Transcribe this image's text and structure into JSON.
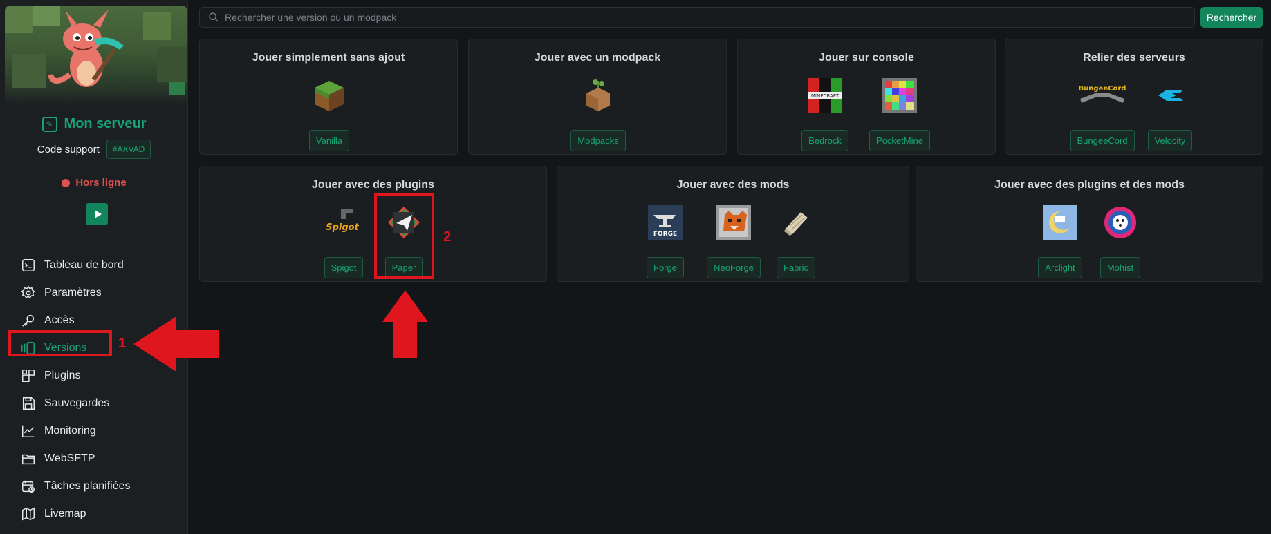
{
  "sidebar": {
    "server_name": "Mon serveur",
    "support_label": "Code support",
    "support_code": "#AXVAD",
    "status": "Hors ligne",
    "nav": [
      {
        "label": "Tableau de bord",
        "icon": "terminal-icon"
      },
      {
        "label": "Paramètres",
        "icon": "gear-icon"
      },
      {
        "label": "Accès",
        "icon": "key-icon"
      },
      {
        "label": "Versions",
        "icon": "versions-icon",
        "active": true
      },
      {
        "label": "Plugins",
        "icon": "plugins-icon"
      },
      {
        "label": "Sauvegardes",
        "icon": "floppy-icon"
      },
      {
        "label": "Monitoring",
        "icon": "chart-line-icon"
      },
      {
        "label": "WebSFTP",
        "icon": "folder-icon"
      },
      {
        "label": "Tâches planifiées",
        "icon": "calendar-clock-icon"
      },
      {
        "label": "Livemap",
        "icon": "map-icon"
      }
    ]
  },
  "search": {
    "placeholder": "Rechercher une version ou un modpack",
    "button": "Rechercher"
  },
  "cards": [
    {
      "title": "Jouer simplement sans ajout",
      "options": [
        "Vanilla"
      ]
    },
    {
      "title": "Jouer avec un modpack",
      "options": [
        "Modpacks"
      ]
    },
    {
      "title": "Jouer sur console",
      "options": [
        "Bedrock",
        "PocketMine"
      ]
    },
    {
      "title": "Relier des serveurs",
      "options": [
        "BungeeCord",
        "Velocity"
      ]
    },
    {
      "title": "Jouer avec des plugins",
      "options": [
        "Spigot",
        "Paper"
      ]
    },
    {
      "title": "Jouer avec des mods",
      "options": [
        "Forge",
        "NeoForge",
        "Fabric"
      ]
    },
    {
      "title": "Jouer avec des plugins et des mods",
      "options": [
        "Arclight",
        "Mohist"
      ]
    }
  ],
  "annotations": {
    "step1": "1",
    "step2": "2"
  },
  "logo_text": {
    "spigot": "Spigot",
    "forge": "FORGE",
    "bungeecord": "BungeeCord",
    "minecraft": "MINECRAFT"
  },
  "colors": {
    "accent": "#19a374",
    "offline": "#e05252",
    "annotation": "#e0161e",
    "background": "#131618"
  }
}
